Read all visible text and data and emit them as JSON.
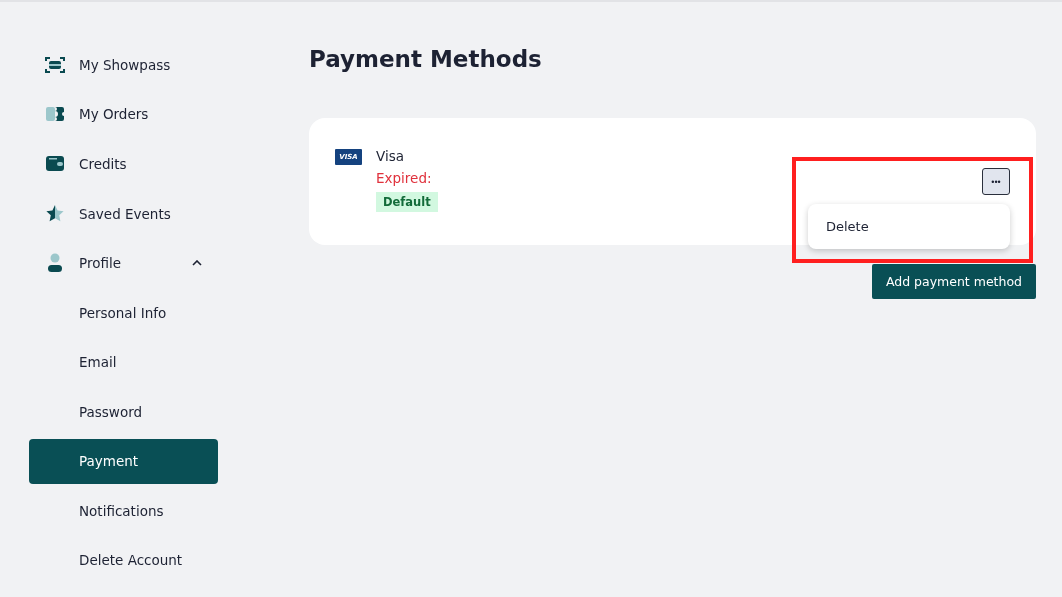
{
  "sidebar": {
    "items": [
      {
        "label": "My Showpass",
        "selected": false
      },
      {
        "label": "My Orders",
        "selected": false
      },
      {
        "label": "Credits",
        "selected": false
      },
      {
        "label": "Saved Events",
        "selected": false
      },
      {
        "label": "Profile",
        "selected": false,
        "expanded": true,
        "children": [
          {
            "label": "Personal Info",
            "selected": false
          },
          {
            "label": "Email",
            "selected": false
          },
          {
            "label": "Password",
            "selected": false
          },
          {
            "label": "Payment",
            "selected": true
          },
          {
            "label": "Notifications",
            "selected": false
          },
          {
            "label": "Delete Account",
            "selected": false
          }
        ]
      }
    ]
  },
  "page_title": "Payment Methods",
  "cards": [
    {
      "brand_mark": "VISA",
      "name": "Visa",
      "status": "Expired:",
      "badge": "Default",
      "menu_button": "•••",
      "menu_open": true,
      "menu_items": [
        "Delete"
      ]
    }
  ],
  "highlight": true,
  "add_button": "Add payment method"
}
